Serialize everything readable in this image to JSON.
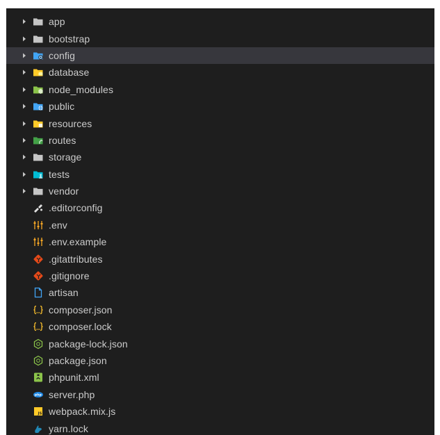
{
  "explorer": {
    "folders": [
      {
        "label": "app",
        "icon": "folder-icon",
        "color": "#c5c5c5"
      },
      {
        "label": "bootstrap",
        "icon": "folder-icon",
        "color": "#c5c5c5"
      },
      {
        "label": "config",
        "icon": "folder-config-icon",
        "color": "#42a5f5",
        "selected": true
      },
      {
        "label": "database",
        "icon": "folder-database-icon",
        "color": "#ffca28"
      },
      {
        "label": "node_modules",
        "icon": "folder-node-icon",
        "color": "#8bc34a"
      },
      {
        "label": "public",
        "icon": "folder-public-icon",
        "color": "#42a5f5"
      },
      {
        "label": "resources",
        "icon": "folder-resources-icon",
        "color": "#ffca28"
      },
      {
        "label": "routes",
        "icon": "folder-routes-icon",
        "color": "#43a047"
      },
      {
        "label": "storage",
        "icon": "folder-icon",
        "color": "#c5c5c5"
      },
      {
        "label": "tests",
        "icon": "folder-tests-icon",
        "color": "#00bcd4"
      },
      {
        "label": "vendor",
        "icon": "folder-icon",
        "color": "#c5c5c5"
      }
    ],
    "files": [
      {
        "label": ".editorconfig",
        "icon": "editorconfig-icon",
        "color": "#e0e0e0"
      },
      {
        "label": ".env",
        "icon": "env-settings-icon",
        "color": "#f9a825"
      },
      {
        "label": ".env.example",
        "icon": "env-settings-icon",
        "color": "#f9a825"
      },
      {
        "label": ".gitattributes",
        "icon": "git-icon",
        "color": "#e64a19"
      },
      {
        "label": ".gitignore",
        "icon": "git-icon",
        "color": "#e64a19"
      },
      {
        "label": "artisan",
        "icon": "file-icon",
        "color": "#42a5f5"
      },
      {
        "label": "composer.json",
        "icon": "json-icon",
        "color": "#fbc02d"
      },
      {
        "label": "composer.lock",
        "icon": "json-icon",
        "color": "#fbc02d"
      },
      {
        "label": "package-lock.json",
        "icon": "nodejs-icon",
        "color": "#8bc34a"
      },
      {
        "label": "package.json",
        "icon": "nodejs-icon",
        "color": "#8bc34a"
      },
      {
        "label": "phpunit.xml",
        "icon": "xml-icon",
        "color": "#8bc34a"
      },
      {
        "label": "server.php",
        "icon": "php-icon",
        "color": "#1e88e5"
      },
      {
        "label": "webpack.mix.js",
        "icon": "javascript-icon",
        "color": "#ffca28"
      },
      {
        "label": "yarn.lock",
        "icon": "yarn-icon",
        "color": "#2188b6"
      }
    ]
  }
}
